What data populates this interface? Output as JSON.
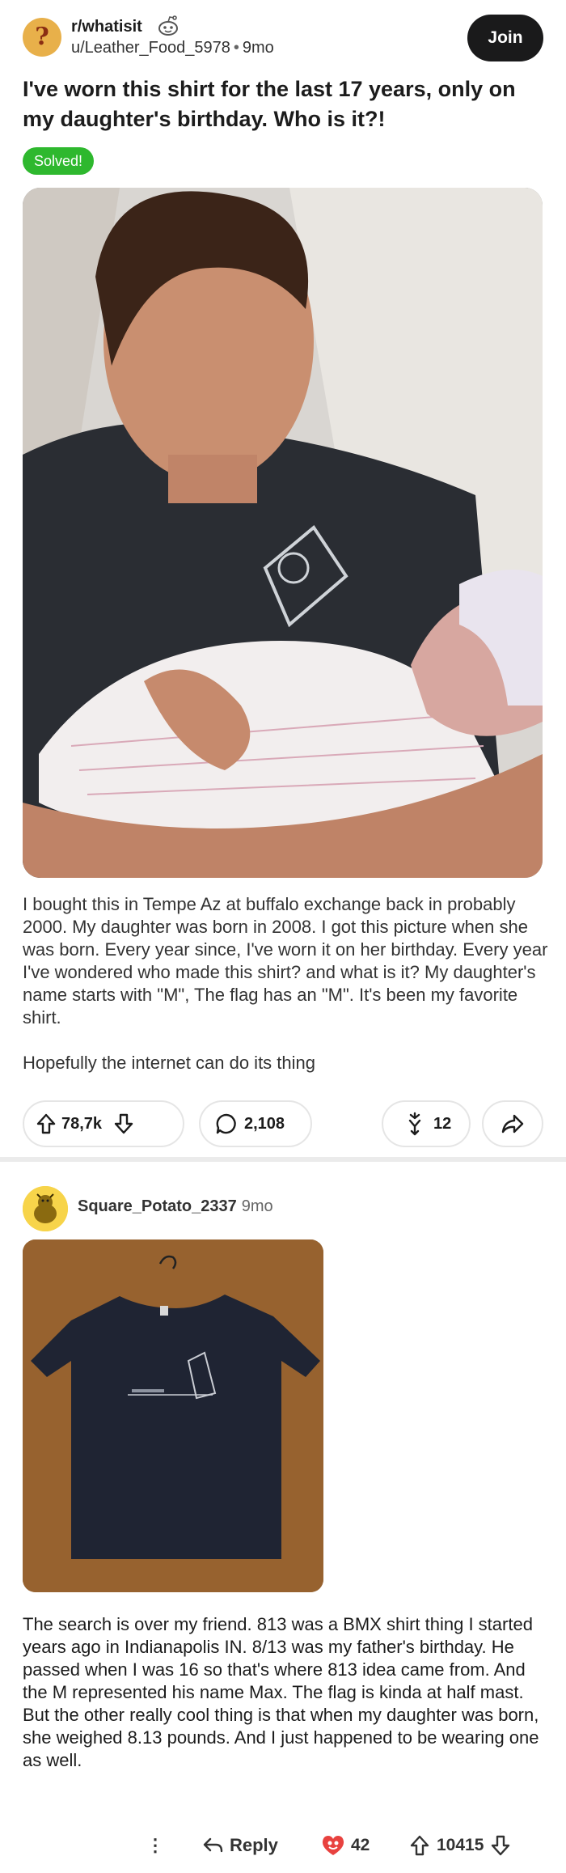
{
  "post": {
    "subreddit": "r/whatisit",
    "author": "u/Leather_Food_5978",
    "age": "9mo",
    "join_label": "Join",
    "title": "I've worn this shirt for the last 17 years, only on my daughter's birthday. Who is it?!",
    "flair": "Solved!",
    "body": [
      "I bought this in Tempe Az at buffalo exchange back in probably 2000. My daughter was born in 2008. I got this picture when she was born. Every year since, I've worn it on her birthday. Every year I've wondered who made this shirt? and what is it? My daughter's name starts with \"M\", The flag has an \"M\". It's been my favorite shirt.",
      "Hopefully the internet can do its thing"
    ],
    "upvotes": "78,7k",
    "comments": "2,108",
    "awards": "12"
  },
  "comment": {
    "author": "Square_Potato_2337",
    "age": "9mo",
    "text": "The search is over my friend. 813 was a BMX shirt thing I started years ago in Indianapolis IN. 8/13 was my father's birthday. He passed when I was 16 so that's where 813 idea came from. And the M represented his name Max. The flag is kinda at half mast. But the other really cool thing is that when my daughter was born, she weighed 8.13 pounds. And I just happened to be wearing one as well.",
    "more_label": "⋮",
    "reply_label": "Reply",
    "awards": "42",
    "upvotes": "10415"
  },
  "colors": {
    "flair_bg": "#2eb82e",
    "join_bg": "#1a1a1b",
    "award_heart": "#e8423f"
  },
  "icons": [
    "snoo-icon",
    "upvote-icon",
    "downvote-icon",
    "comment-icon",
    "award-icon",
    "share-icon",
    "reply-icon",
    "heart-award-icon",
    "more-icon"
  ]
}
